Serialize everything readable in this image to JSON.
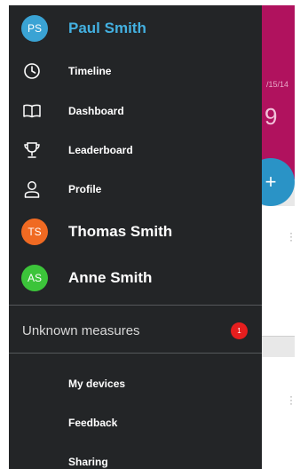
{
  "background": {
    "date_fragment": "/15/14",
    "big_number": "9",
    "fab_symbol": "+",
    "colors": {
      "header": "#b0125e",
      "fab": "#2a93c6"
    }
  },
  "drawer": {
    "current_account": {
      "initials": "PS",
      "name": "Paul Smith",
      "color": "#3aa3d4"
    },
    "nav_items": [
      {
        "label": "Timeline",
        "icon": "clock-icon"
      },
      {
        "label": "Dashboard",
        "icon": "book-icon"
      },
      {
        "label": "Leaderboard",
        "icon": "trophy-icon"
      },
      {
        "label": "Profile",
        "icon": "person-icon"
      }
    ],
    "other_accounts": [
      {
        "initials": "TS",
        "name": "Thomas Smith",
        "color": "#f06a22"
      },
      {
        "initials": "AS",
        "name": "Anne Smith",
        "color": "#3cc43a"
      }
    ],
    "unknown_measures": {
      "label": "Unknown measures",
      "badge": "1",
      "badge_color": "#e61e1e"
    },
    "secondary_items": [
      {
        "label": "My devices"
      },
      {
        "label": "Feedback"
      },
      {
        "label": "Sharing"
      }
    ]
  }
}
